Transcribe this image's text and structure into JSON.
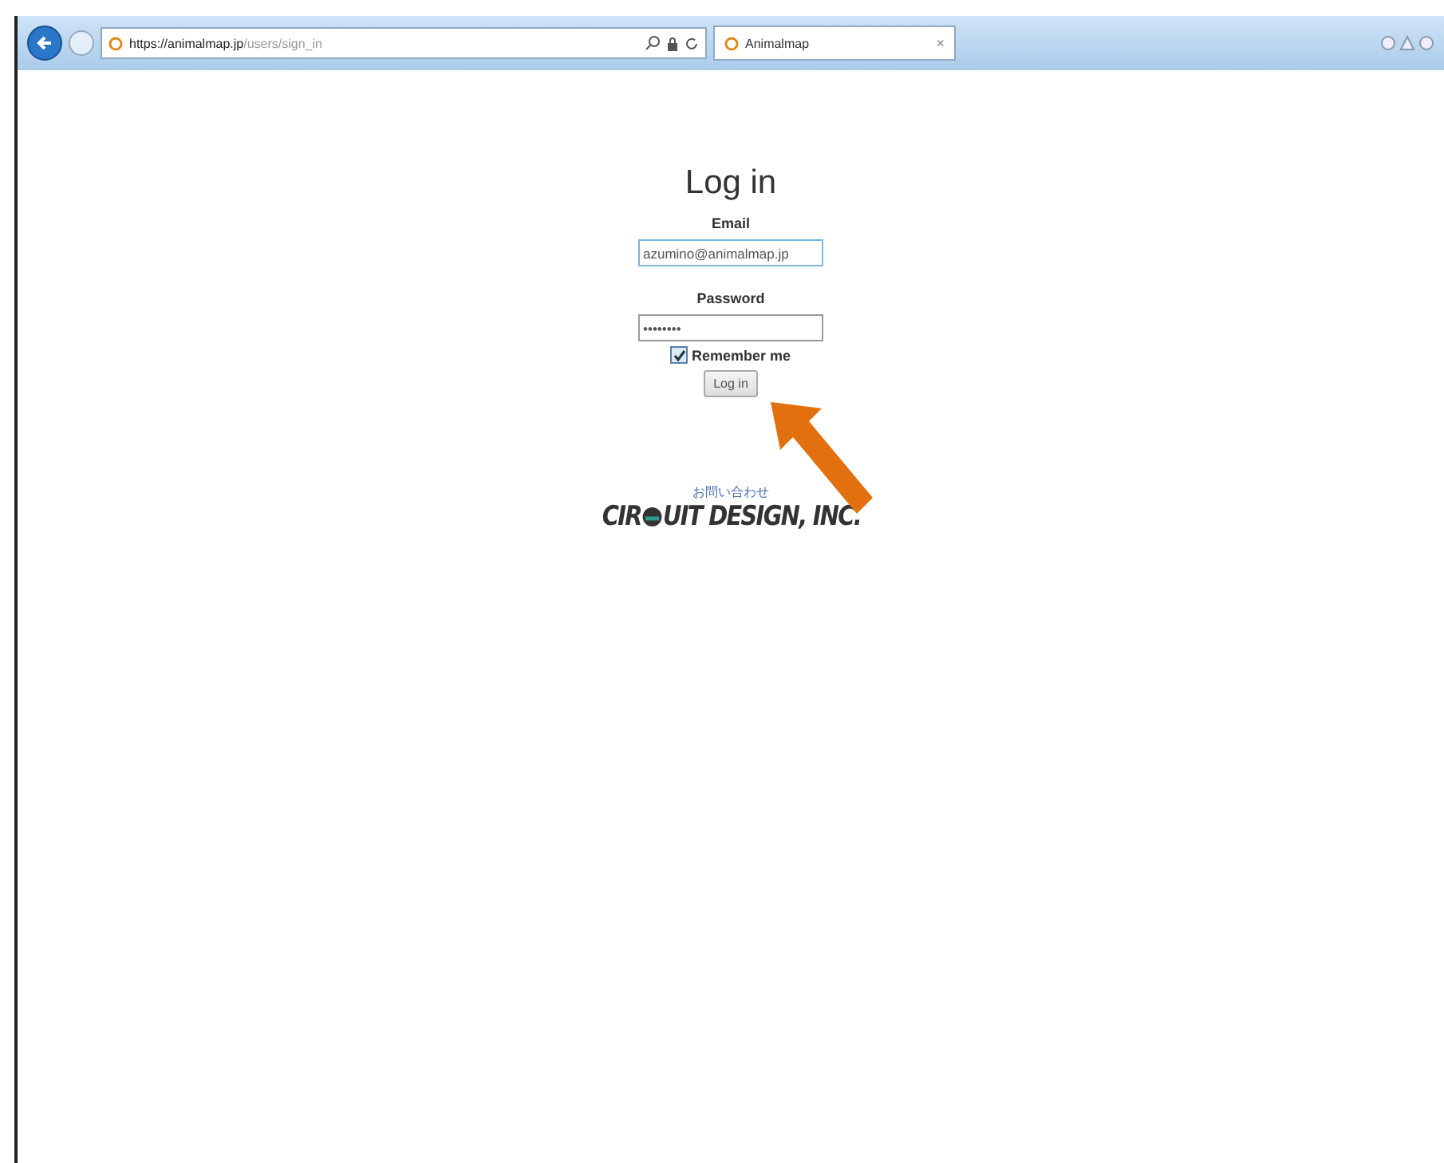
{
  "browser": {
    "address": {
      "scheme": "https://",
      "host": "animalmap.jp",
      "path": "/users/sign_in"
    },
    "tab": {
      "title": "Animalmap",
      "close": "×"
    }
  },
  "login": {
    "title": "Log in",
    "email": {
      "label": "Email",
      "value": "azumino@animalmap.jp"
    },
    "password": {
      "label": "Password",
      "value": "••••••••"
    },
    "remember": {
      "label": "Remember me",
      "checked": true
    },
    "submit": "Log in"
  },
  "footer": {
    "contact": "お問い合わせ",
    "logo": {
      "before": "CIR",
      "after": "UIT DESIGN, INC."
    }
  }
}
